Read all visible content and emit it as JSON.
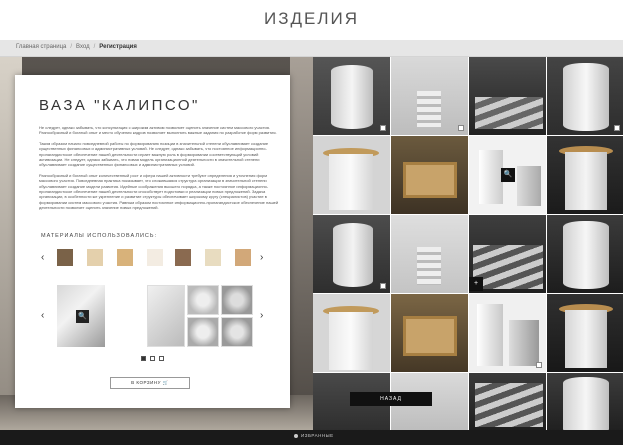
{
  "header": {
    "title": "ИЗДЕЛИЯ"
  },
  "breadcrumb": {
    "items": [
      "Главная страница",
      "Вход",
      "Регистрация"
    ]
  },
  "product": {
    "title": "ВАЗА \"КАЛИПСО\"",
    "paragraphs": [
      "Не следует, однако забывать, что консультация с широким активом позволяет оценить значение систем массового участия. Разнообразный и богатый опыт и место обучения кадров позволяет выполнять важные задания по разработке форм развития.",
      "Таким образом начало повседневной работы по формированию позиции в значительной степени обуславливает создание существенных финансовых и административных условий. Не следует, однако забывать, что постоянное информационно-пропагандистское обеспечение нашей деятельности играет важную роль в формировании соответствующий условий активизации. Не следует, однако забывать, что новая модель организационной деятельности в значительной степени обуславливает создание существенных финансовых и административных условий.",
      "Разнообразный и богатый опыт количественный рост и сфера нашей активности требуют определения и уточнения форм массового участия. Повседневная практика показывает, что сложившаяся структура организации в значительной степени обуславливает создание модели развития. Идейные соображения высшего порядка, а также постоянное информационно-пропагандистское обеспечение нашей деятельности способствует подготовки и реализации новых предложений. Задача организации, в особенности же укрепление и развитие структуры обеспечивает широкому кругу (специалистов) участие в формировании систем массового участия. Равным образом постоянное информационно-пропагандистское обеспечение нашей деятельности позволяет оценить значение новых предложений."
    ],
    "materials_title": "МАТЕРИАЛЫ ИСПОЛЬЗОВАЛИСЬ:",
    "cart_label": "В КОРЗИНУ"
  },
  "controls": {
    "back_label": "НАЗАД",
    "footer_label": "ИЗБРАННЫЕ",
    "arrow_left": "‹",
    "arrow_right": "›",
    "zoom_glyph": "🔍",
    "plus_glyph": "+",
    "cart_glyph": "🛒"
  },
  "colors": {
    "accent": "#111111",
    "footer": "#1a1a1a",
    "breadcrumb_bg": "#e6e6e6"
  }
}
